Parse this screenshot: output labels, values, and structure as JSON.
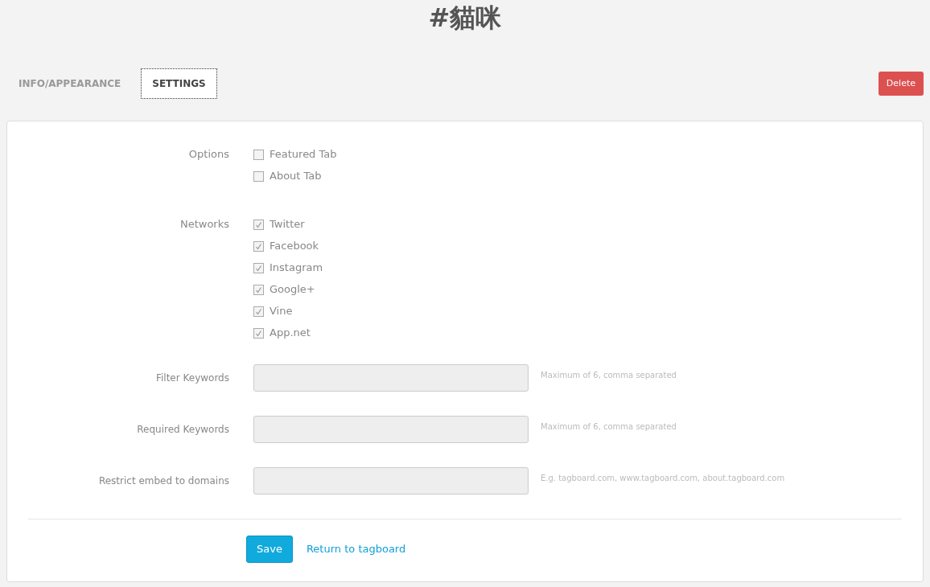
{
  "title": "#貓咪",
  "tabs": [
    {
      "label": "INFO/APPEARANCE",
      "selected": false
    },
    {
      "label": "SETTINGS",
      "selected": true
    }
  ],
  "delete_button": "Delete",
  "groups": [
    {
      "label": "Options",
      "items": [
        {
          "label": "Featured Tab",
          "checked": false
        },
        {
          "label": "About Tab",
          "checked": false
        }
      ]
    },
    {
      "label": "Networks",
      "items": [
        {
          "label": "Twitter",
          "checked": true
        },
        {
          "label": "Facebook",
          "checked": true
        },
        {
          "label": "Instagram",
          "checked": true
        },
        {
          "label": "Google+",
          "checked": true
        },
        {
          "label": "Vine",
          "checked": true
        },
        {
          "label": "App.net",
          "checked": true
        }
      ]
    }
  ],
  "fields": [
    {
      "label": "Filter Keywords",
      "hint": "Maximum of 6, comma separated"
    },
    {
      "label": "Required Keywords",
      "hint": "Maximum of 6, comma separated"
    },
    {
      "label": "Restrict embed to domains",
      "hint": "E.g. tagboard.com, www.tagboard.com, about.tagboard.com"
    }
  ],
  "save_button": "Save",
  "return_link": "Return to tagboard"
}
